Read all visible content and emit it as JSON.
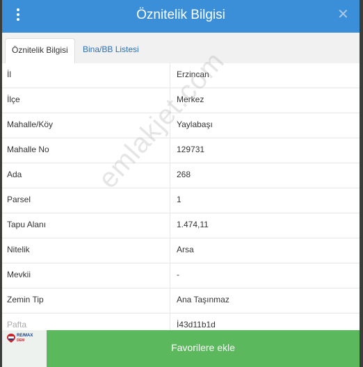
{
  "header": {
    "title": "Öznitelik Bilgisi",
    "close_symbol": "✕",
    "menu_icon": "kebab-menu-icon"
  },
  "tabs": [
    {
      "label": "Öznitelik Bilgisi",
      "active": true
    },
    {
      "label": "Bina/BB Listesi",
      "active": false
    }
  ],
  "rows": [
    {
      "label": "İl",
      "value": "Erzincan"
    },
    {
      "label": "İlçe",
      "value": "Merkez"
    },
    {
      "label": "Mahalle/Köy",
      "value": "Yaylabaşı"
    },
    {
      "label": "Mahalle No",
      "value": "129731"
    },
    {
      "label": "Ada",
      "value": "268"
    },
    {
      "label": "Parsel",
      "value": "1"
    },
    {
      "label": "Tapu Alanı",
      "value": "1.474,11"
    },
    {
      "label": "Nitelik",
      "value": "Arsa"
    },
    {
      "label": "Mevkii",
      "value": "-"
    },
    {
      "label": "Zemin Tip",
      "value": "Ana Taşınmaz"
    },
    {
      "label": "Pafta",
      "value": "İ43d11b1d"
    }
  ],
  "footer": {
    "favorite_label": "Favorilere ekle",
    "logo_text": "RE/MAX",
    "logo_subtext": "DEM"
  },
  "watermark": "emlakjet.com",
  "colors": {
    "header": "#3b8fd9",
    "button": "#5cb85c",
    "tab_link": "#2a6fb3"
  }
}
